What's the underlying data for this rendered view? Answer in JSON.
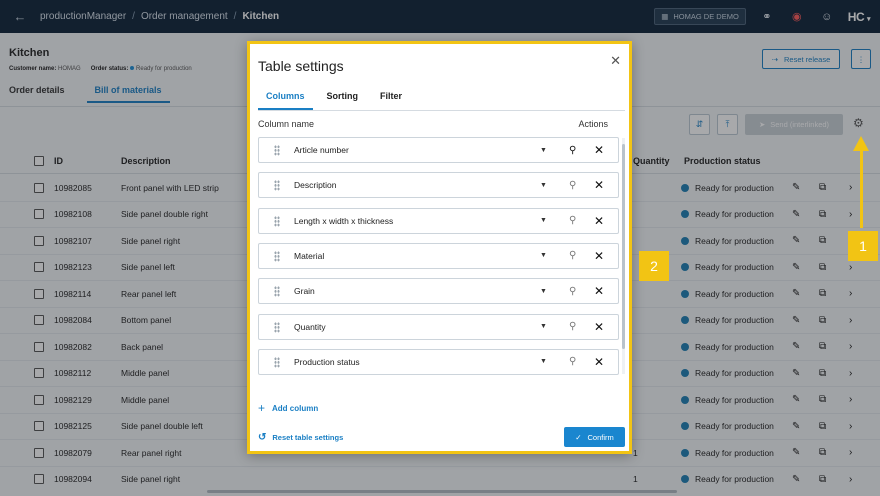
{
  "topbar": {
    "breadcrumbs": [
      "productionManager",
      "Order management",
      "Kitchen"
    ],
    "tenant": "HOMAG DE DEMO",
    "logo": "HC"
  },
  "page": {
    "title": "Kitchen",
    "customer_label": "Customer name:",
    "customer_value": "HOMAG",
    "status_label": "Order status:",
    "status_value": "Ready for production",
    "tabs": [
      "Order details",
      "Bill of materials"
    ],
    "active_tab": "Bill of materials",
    "reset_release": "Reset release",
    "send_button": "Send (interlinked)"
  },
  "table": {
    "headers": [
      "ID",
      "Description",
      "Quantity",
      "Production status"
    ],
    "rows": [
      {
        "id": "10982085",
        "desc": "Front panel with LED strip",
        "qty": "",
        "status": "Ready for production"
      },
      {
        "id": "10982108",
        "desc": "Side panel double right",
        "qty": "",
        "status": "Ready for production"
      },
      {
        "id": "10982107",
        "desc": "Side panel right",
        "qty": "",
        "status": "Ready for production"
      },
      {
        "id": "10982123",
        "desc": "Side panel left",
        "qty": "",
        "status": "Ready for production"
      },
      {
        "id": "10982114",
        "desc": "Rear panel left",
        "qty": "",
        "status": "Ready for production"
      },
      {
        "id": "10982084",
        "desc": "Bottom panel",
        "qty": "",
        "status": "Ready for production"
      },
      {
        "id": "10982082",
        "desc": "Back panel",
        "qty": "",
        "status": "Ready for production"
      },
      {
        "id": "10982112",
        "desc": "Middle panel",
        "qty": "",
        "status": "Ready for production"
      },
      {
        "id": "10982129",
        "desc": "Middle panel",
        "qty": "",
        "status": "Ready for production"
      },
      {
        "id": "10982125",
        "desc": "Side panel double left",
        "qty": "",
        "status": "Ready for production"
      },
      {
        "id": "10982079",
        "desc": "Rear panel right",
        "qty": "1",
        "status": "Ready for production"
      },
      {
        "id": "10982094",
        "desc": "Side panel right",
        "qty": "1",
        "status": "Ready for production"
      }
    ]
  },
  "modal": {
    "title": "Table settings",
    "tabs": [
      "Columns",
      "Sorting",
      "Filter"
    ],
    "col_name_header": "Column name",
    "actions_header": "Actions",
    "columns": [
      {
        "name": "Article number",
        "pinned": true
      },
      {
        "name": "Description",
        "pinned": false
      },
      {
        "name": "Length x width x thickness",
        "pinned": false
      },
      {
        "name": "Material",
        "pinned": false
      },
      {
        "name": "Grain",
        "pinned": false
      },
      {
        "name": "Quantity",
        "pinned": false
      },
      {
        "name": "Production status",
        "pinned": false
      }
    ],
    "add_column": "Add column",
    "reset_settings": "Reset table settings",
    "confirm": "Confirm"
  },
  "callouts": [
    "1",
    "2"
  ],
  "colors": {
    "topbar": "#0d2238",
    "accent": "#1a7fc4",
    "highlight": "#f2c414",
    "status_dot": "#1e7fb4"
  }
}
